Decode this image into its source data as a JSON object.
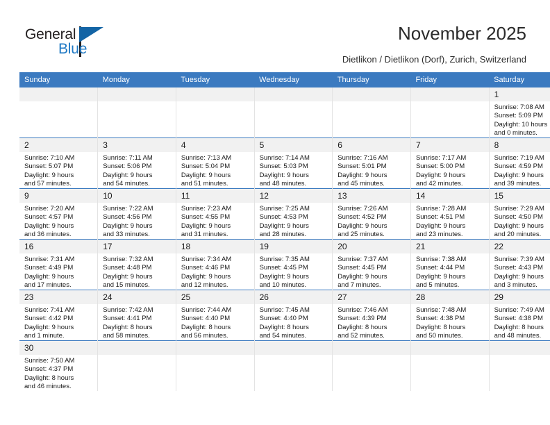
{
  "brand": {
    "name_top": "General",
    "name_bottom": "Blue",
    "accent_color": "#1f79c4",
    "flag_color": "#1364a5"
  },
  "header": {
    "title": "November 2025",
    "subtitle": "Dietlikon / Dietlikon (Dorf), Zurich, Switzerland",
    "header_bg": "#3b7ac0",
    "daynum_bg": "#f1f1f1"
  },
  "weekdays": [
    "Sunday",
    "Monday",
    "Tuesday",
    "Wednesday",
    "Thursday",
    "Friday",
    "Saturday"
  ],
  "labels": {
    "sunrise": "Sunrise:",
    "sunset": "Sunset:",
    "daylight": "Daylight:"
  },
  "weeks": [
    [
      {
        "day": "",
        "blank": true
      },
      {
        "day": "",
        "blank": true
      },
      {
        "day": "",
        "blank": true
      },
      {
        "day": "",
        "blank": true
      },
      {
        "day": "",
        "blank": true
      },
      {
        "day": "",
        "blank": true
      },
      {
        "day": "1",
        "sunrise": "Sunrise: 7:08 AM",
        "sunset": "Sunset: 5:09 PM",
        "daylight_1": "Daylight: 10 hours",
        "daylight_2": "and 0 minutes."
      }
    ],
    [
      {
        "day": "2",
        "sunrise": "Sunrise: 7:10 AM",
        "sunset": "Sunset: 5:07 PM",
        "daylight_1": "Daylight: 9 hours",
        "daylight_2": "and 57 minutes."
      },
      {
        "day": "3",
        "sunrise": "Sunrise: 7:11 AM",
        "sunset": "Sunset: 5:06 PM",
        "daylight_1": "Daylight: 9 hours",
        "daylight_2": "and 54 minutes."
      },
      {
        "day": "4",
        "sunrise": "Sunrise: 7:13 AM",
        "sunset": "Sunset: 5:04 PM",
        "daylight_1": "Daylight: 9 hours",
        "daylight_2": "and 51 minutes."
      },
      {
        "day": "5",
        "sunrise": "Sunrise: 7:14 AM",
        "sunset": "Sunset: 5:03 PM",
        "daylight_1": "Daylight: 9 hours",
        "daylight_2": "and 48 minutes."
      },
      {
        "day": "6",
        "sunrise": "Sunrise: 7:16 AM",
        "sunset": "Sunset: 5:01 PM",
        "daylight_1": "Daylight: 9 hours",
        "daylight_2": "and 45 minutes."
      },
      {
        "day": "7",
        "sunrise": "Sunrise: 7:17 AM",
        "sunset": "Sunset: 5:00 PM",
        "daylight_1": "Daylight: 9 hours",
        "daylight_2": "and 42 minutes."
      },
      {
        "day": "8",
        "sunrise": "Sunrise: 7:19 AM",
        "sunset": "Sunset: 4:59 PM",
        "daylight_1": "Daylight: 9 hours",
        "daylight_2": "and 39 minutes."
      }
    ],
    [
      {
        "day": "9",
        "sunrise": "Sunrise: 7:20 AM",
        "sunset": "Sunset: 4:57 PM",
        "daylight_1": "Daylight: 9 hours",
        "daylight_2": "and 36 minutes."
      },
      {
        "day": "10",
        "sunrise": "Sunrise: 7:22 AM",
        "sunset": "Sunset: 4:56 PM",
        "daylight_1": "Daylight: 9 hours",
        "daylight_2": "and 33 minutes."
      },
      {
        "day": "11",
        "sunrise": "Sunrise: 7:23 AM",
        "sunset": "Sunset: 4:55 PM",
        "daylight_1": "Daylight: 9 hours",
        "daylight_2": "and 31 minutes."
      },
      {
        "day": "12",
        "sunrise": "Sunrise: 7:25 AM",
        "sunset": "Sunset: 4:53 PM",
        "daylight_1": "Daylight: 9 hours",
        "daylight_2": "and 28 minutes."
      },
      {
        "day": "13",
        "sunrise": "Sunrise: 7:26 AM",
        "sunset": "Sunset: 4:52 PM",
        "daylight_1": "Daylight: 9 hours",
        "daylight_2": "and 25 minutes."
      },
      {
        "day": "14",
        "sunrise": "Sunrise: 7:28 AM",
        "sunset": "Sunset: 4:51 PM",
        "daylight_1": "Daylight: 9 hours",
        "daylight_2": "and 23 minutes."
      },
      {
        "day": "15",
        "sunrise": "Sunrise: 7:29 AM",
        "sunset": "Sunset: 4:50 PM",
        "daylight_1": "Daylight: 9 hours",
        "daylight_2": "and 20 minutes."
      }
    ],
    [
      {
        "day": "16",
        "sunrise": "Sunrise: 7:31 AM",
        "sunset": "Sunset: 4:49 PM",
        "daylight_1": "Daylight: 9 hours",
        "daylight_2": "and 17 minutes."
      },
      {
        "day": "17",
        "sunrise": "Sunrise: 7:32 AM",
        "sunset": "Sunset: 4:48 PM",
        "daylight_1": "Daylight: 9 hours",
        "daylight_2": "and 15 minutes."
      },
      {
        "day": "18",
        "sunrise": "Sunrise: 7:34 AM",
        "sunset": "Sunset: 4:46 PM",
        "daylight_1": "Daylight: 9 hours",
        "daylight_2": "and 12 minutes."
      },
      {
        "day": "19",
        "sunrise": "Sunrise: 7:35 AM",
        "sunset": "Sunset: 4:45 PM",
        "daylight_1": "Daylight: 9 hours",
        "daylight_2": "and 10 minutes."
      },
      {
        "day": "20",
        "sunrise": "Sunrise: 7:37 AM",
        "sunset": "Sunset: 4:45 PM",
        "daylight_1": "Daylight: 9 hours",
        "daylight_2": "and 7 minutes."
      },
      {
        "day": "21",
        "sunrise": "Sunrise: 7:38 AM",
        "sunset": "Sunset: 4:44 PM",
        "daylight_1": "Daylight: 9 hours",
        "daylight_2": "and 5 minutes."
      },
      {
        "day": "22",
        "sunrise": "Sunrise: 7:39 AM",
        "sunset": "Sunset: 4:43 PM",
        "daylight_1": "Daylight: 9 hours",
        "daylight_2": "and 3 minutes."
      }
    ],
    [
      {
        "day": "23",
        "sunrise": "Sunrise: 7:41 AM",
        "sunset": "Sunset: 4:42 PM",
        "daylight_1": "Daylight: 9 hours",
        "daylight_2": "and 1 minute."
      },
      {
        "day": "24",
        "sunrise": "Sunrise: 7:42 AM",
        "sunset": "Sunset: 4:41 PM",
        "daylight_1": "Daylight: 8 hours",
        "daylight_2": "and 58 minutes."
      },
      {
        "day": "25",
        "sunrise": "Sunrise: 7:44 AM",
        "sunset": "Sunset: 4:40 PM",
        "daylight_1": "Daylight: 8 hours",
        "daylight_2": "and 56 minutes."
      },
      {
        "day": "26",
        "sunrise": "Sunrise: 7:45 AM",
        "sunset": "Sunset: 4:40 PM",
        "daylight_1": "Daylight: 8 hours",
        "daylight_2": "and 54 minutes."
      },
      {
        "day": "27",
        "sunrise": "Sunrise: 7:46 AM",
        "sunset": "Sunset: 4:39 PM",
        "daylight_1": "Daylight: 8 hours",
        "daylight_2": "and 52 minutes."
      },
      {
        "day": "28",
        "sunrise": "Sunrise: 7:48 AM",
        "sunset": "Sunset: 4:38 PM",
        "daylight_1": "Daylight: 8 hours",
        "daylight_2": "and 50 minutes."
      },
      {
        "day": "29",
        "sunrise": "Sunrise: 7:49 AM",
        "sunset": "Sunset: 4:38 PM",
        "daylight_1": "Daylight: 8 hours",
        "daylight_2": "and 48 minutes."
      }
    ],
    [
      {
        "day": "30",
        "sunrise": "Sunrise: 7:50 AM",
        "sunset": "Sunset: 4:37 PM",
        "daylight_1": "Daylight: 8 hours",
        "daylight_2": "and 46 minutes."
      },
      {
        "day": "",
        "blank": true
      },
      {
        "day": "",
        "blank": true
      },
      {
        "day": "",
        "blank": true
      },
      {
        "day": "",
        "blank": true
      },
      {
        "day": "",
        "blank": true
      },
      {
        "day": "",
        "blank": true
      }
    ]
  ]
}
